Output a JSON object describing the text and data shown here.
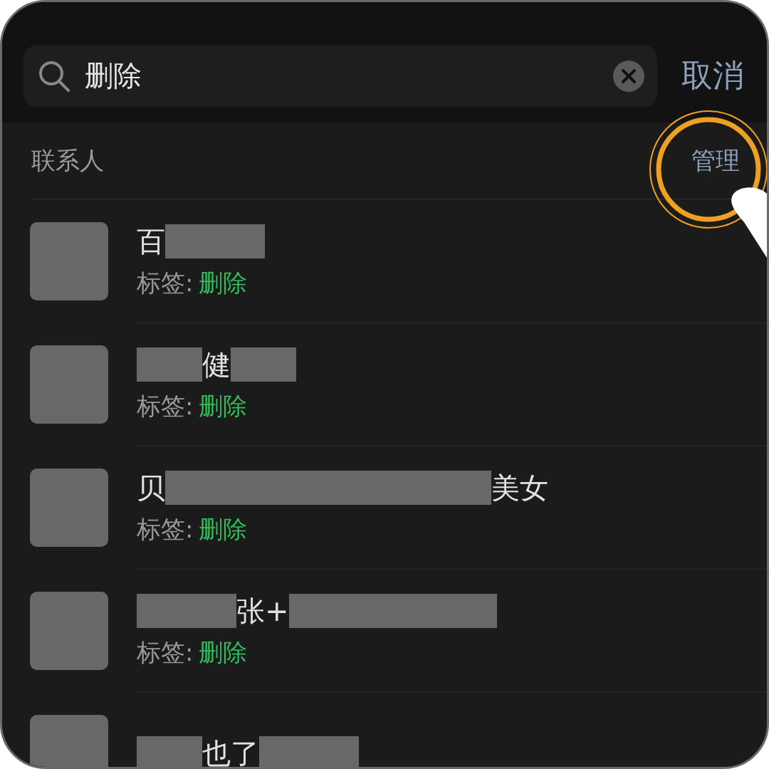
{
  "search": {
    "value": "删除"
  },
  "cancel": "取消",
  "section": {
    "title": "联系人",
    "action": "管理",
    "action_highlighted": true
  },
  "contacts": [
    {
      "name": [
        {
          "kind": "text",
          "text": "百"
        },
        {
          "kind": "shortblock"
        }
      ],
      "tag_label": "标签:",
      "tag": "删除"
    },
    {
      "name": [
        {
          "kind": "tinyblock"
        },
        {
          "kind": "text",
          "text": "健"
        },
        {
          "kind": "tinyblock"
        }
      ],
      "tag_label": "标签:",
      "tag": "删除"
    },
    {
      "name": [
        {
          "kind": "text",
          "text": "贝"
        },
        {
          "kind": "longblock"
        },
        {
          "kind": "text",
          "text": "美女"
        }
      ],
      "tag_label": "标签:",
      "tag": "删除"
    },
    {
      "name": [
        {
          "kind": "shortblock"
        },
        {
          "kind": "text",
          "text": "张+"
        },
        {
          "kind": "midblock"
        }
      ],
      "tag_label": "标签:",
      "tag": "删除"
    },
    {
      "name": [
        {
          "kind": "tinyblock"
        },
        {
          "kind": "text",
          "text": "也了"
        },
        {
          "kind": "shortblock"
        }
      ]
    }
  ]
}
